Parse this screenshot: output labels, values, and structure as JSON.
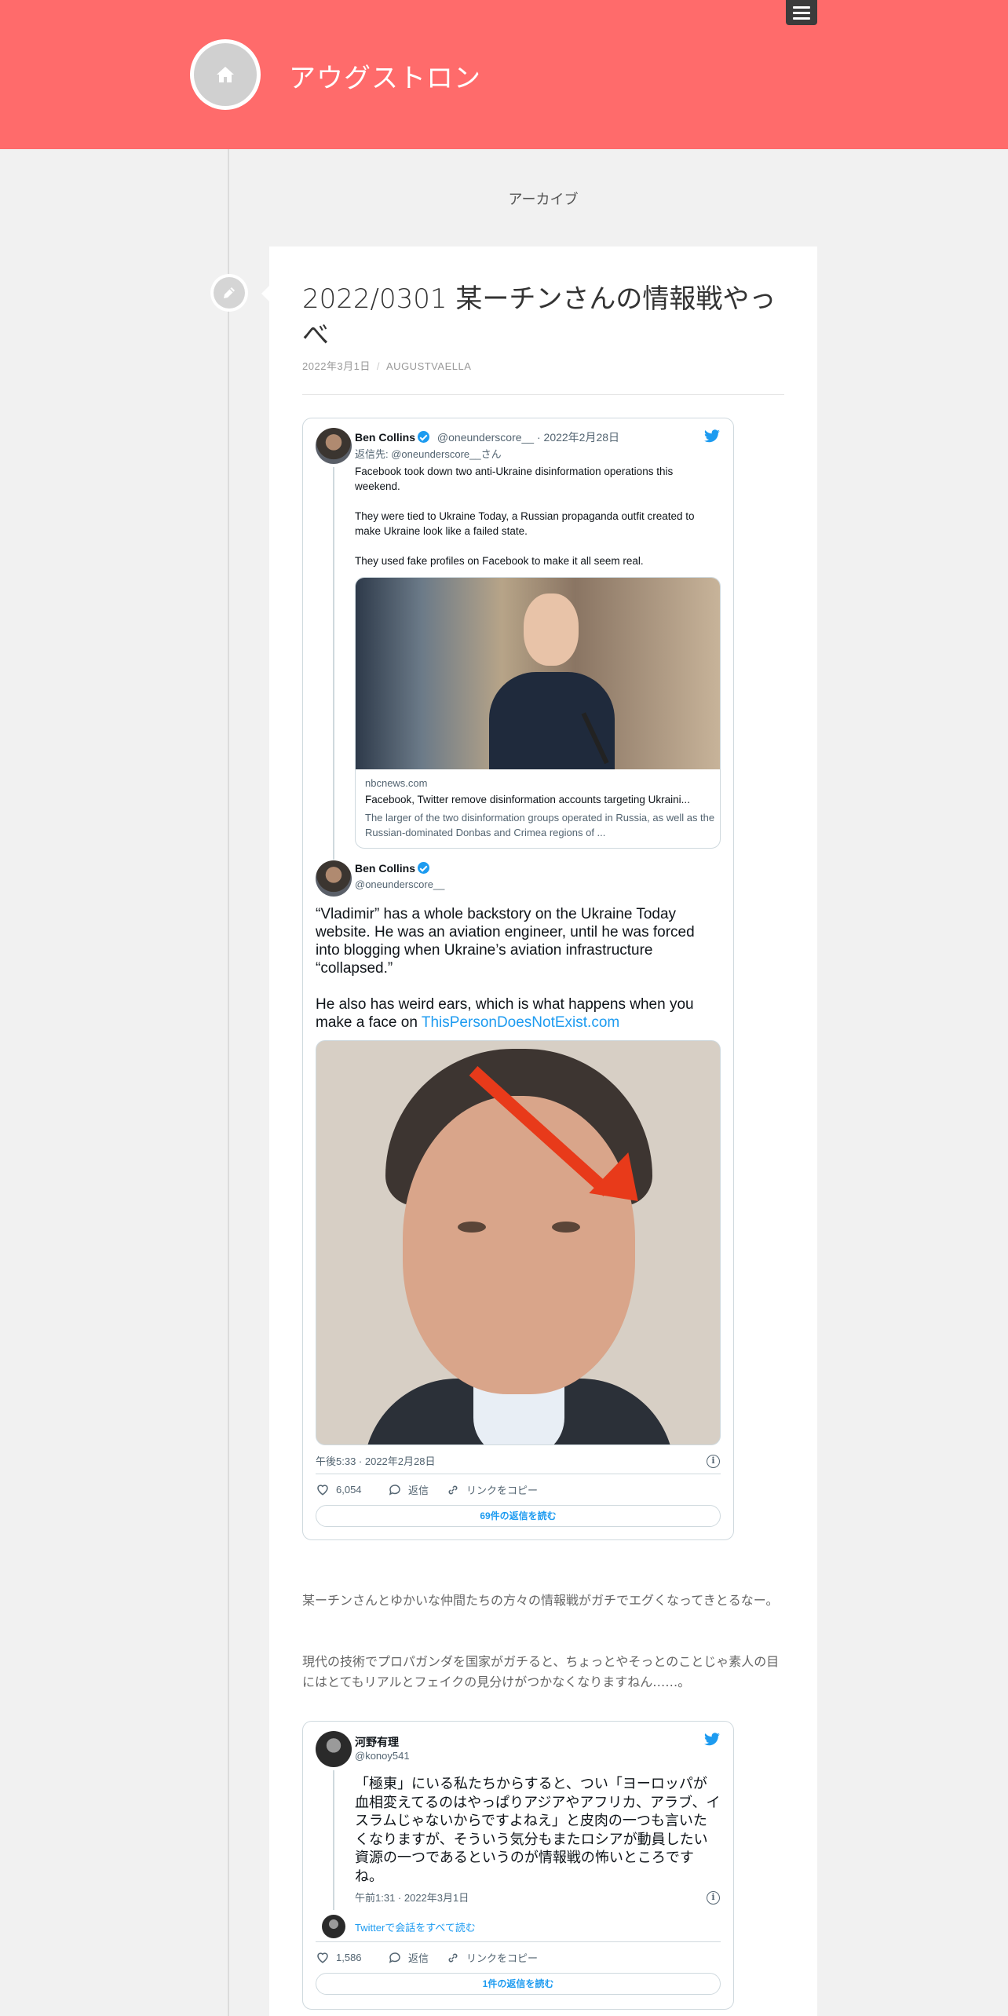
{
  "header": {
    "site_title": "アウグストロン",
    "menu_icon": "hamburger-icon",
    "home_icon": "home-icon",
    "bg_color": "#ff6b6b"
  },
  "archive_label": "アーカイブ",
  "post": {
    "title": "2022/0301 某ーチンさんの情報戦やっべ",
    "date": "2022年3月1日",
    "author": "AUGUSTVAELLA",
    "icon": "pencil-icon"
  },
  "tweet1": {
    "name": "Ben Collins",
    "handle": "@oneunderscore__",
    "date": "· 2022年2月28日",
    "reply_to": "返信先: @oneunderscore__さん",
    "text": "Facebook took down two anti-Ukraine disinformation operations this weekend.\n\nThey were tied to Ukraine Today, a Russian propaganda outfit created to make Ukraine look like a failed state.\n\nThey used fake profiles on Facebook to make it all seem real.",
    "card": {
      "domain": "nbcnews.com",
      "title": "Facebook, Twitter remove disinformation accounts targeting Ukraini...",
      "desc": "The larger of the two disinformation groups operated in Russia, as well as the Russian-dominated Donbas and Crimea regions of ..."
    }
  },
  "tweet2": {
    "name": "Ben Collins",
    "handle": "@oneunderscore__",
    "text_a": "“Vladimir” has a whole backstory on the Ukraine Today website. He was an aviation engineer, until he was forced into blogging when Ukraine’s aviation infrastructure “collapsed.”\n\nHe also has weird ears, which is what happens when you make a face on ",
    "link": "ThisPersonDoesNotExist.com",
    "timestamp": "午後5:33 · 2022年2月28日",
    "likes": "6,054",
    "reply": "返信",
    "copy_link": "リンクをコピー",
    "read_replies": "69件の返信を読む"
  },
  "paragraphs": [
    "某ーチンさんとゆかいな仲間たちの方々の情報戦がガチでエグくなってきとるなー。",
    "現代の技術でプロパガンダを国家がガチると、ちょっとやそっとのことじゃ素人の目にはとてもリアルとフェイクの見分けがつかなくなりますねん……。"
  ],
  "tweet3": {
    "name": "河野有理",
    "handle": "@konoy541",
    "text": "「極東」にいる私たちからすると、つい「ヨーロッパが血相変えてるのはやっぱりアジアやアフリカ、アラブ、イスラムじゃないからですよねえ」と皮肉の一つも言いたくなりますが、そういう気分もまたロシアが動員したい資源の一つであるというのが情報戦の怖いところですね。",
    "timestamp": "午前1:31 · 2022年3月1日",
    "conversation": "Twitterで会話をすべて読む",
    "likes": "1,586",
    "reply": "返信",
    "copy_link": "リンクをコピー",
    "read_replies": "1件の返信を読む"
  },
  "colors": {
    "twitter_blue": "#1d9bf0",
    "header": "#ff6b6b"
  }
}
